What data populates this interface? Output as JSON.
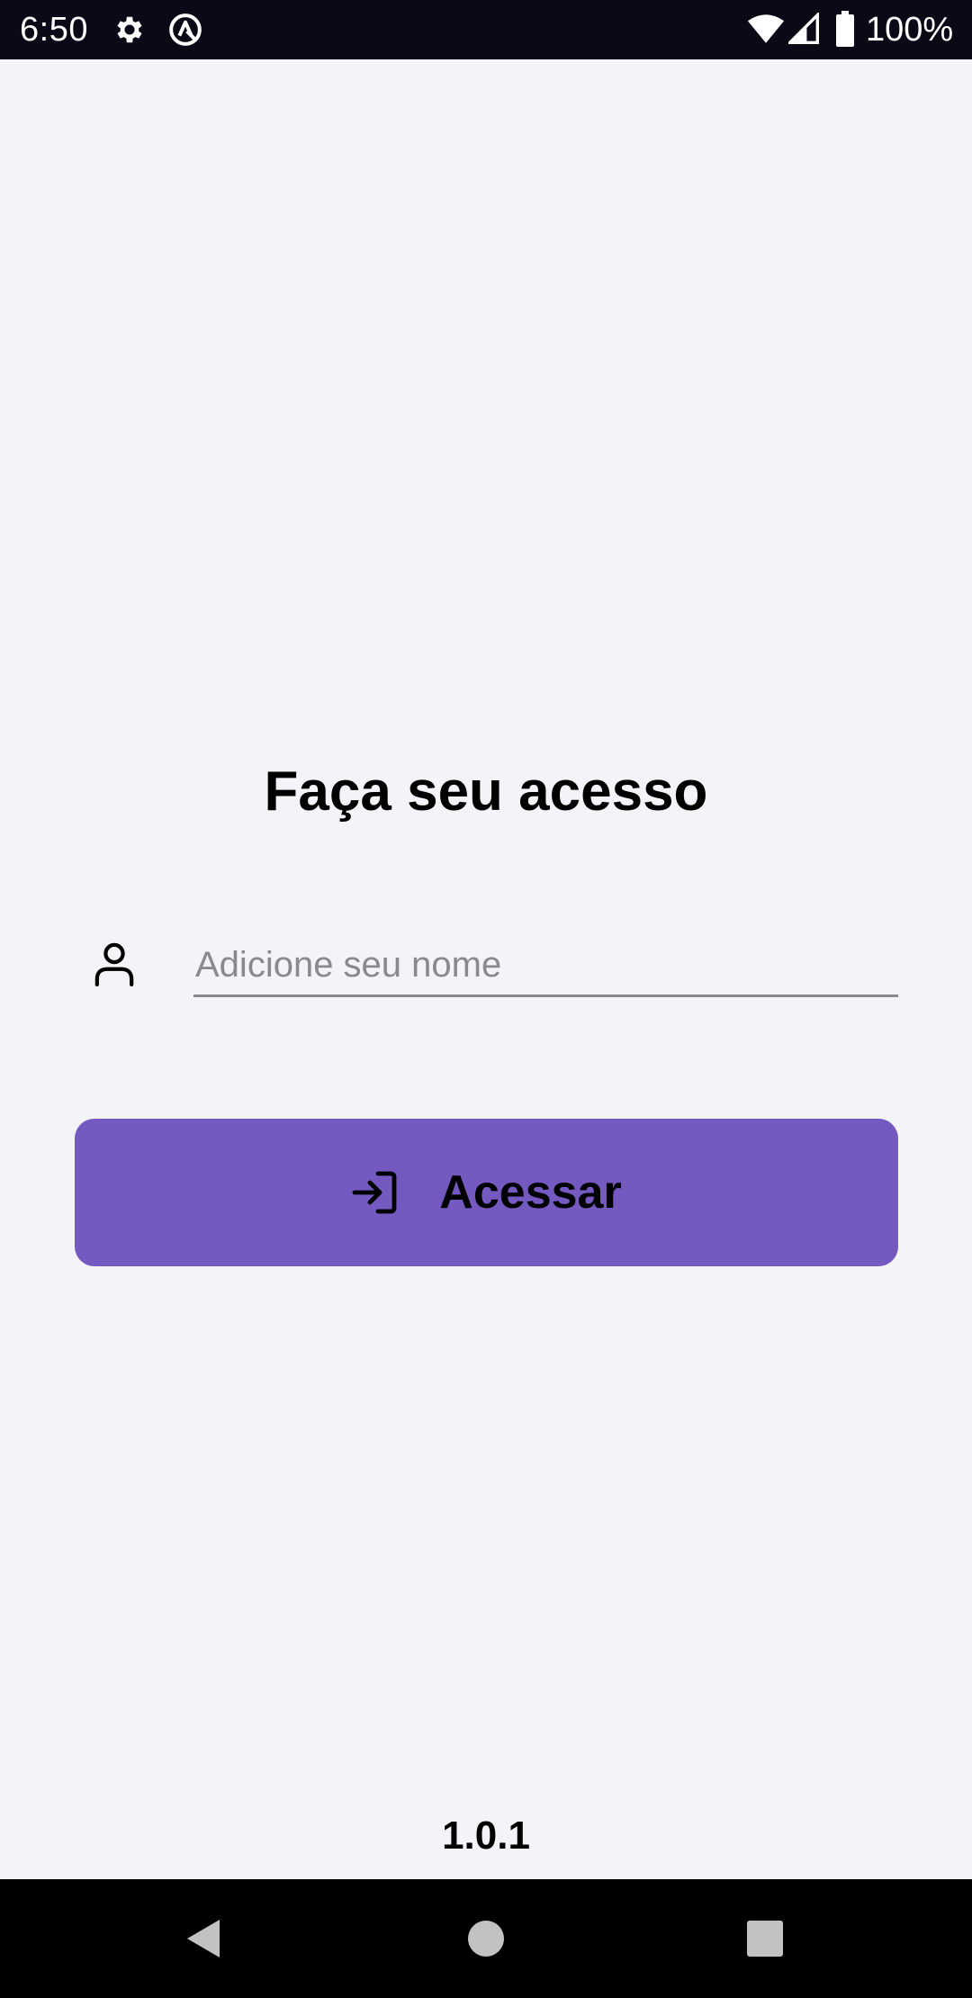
{
  "status_bar": {
    "time": "6:50",
    "battery": "100%",
    "icons": [
      "gear-icon",
      "sync-icon",
      "wifi-icon",
      "signal-icon",
      "battery-icon"
    ]
  },
  "login": {
    "title": "Faça seu acesso",
    "name_input": {
      "value": "",
      "placeholder": "Adicione seu nome"
    },
    "access_button_label": "Acessar",
    "user_icon": "user-icon",
    "button_icon": "login-icon"
  },
  "version": "1.0.1",
  "colors": {
    "background": "#f4f3f8",
    "accent": "#7459c0",
    "status_bar": "#0a0a17",
    "nav_bar": "#000000"
  },
  "nav_bar": {
    "buttons": [
      "back",
      "home",
      "recents"
    ]
  }
}
